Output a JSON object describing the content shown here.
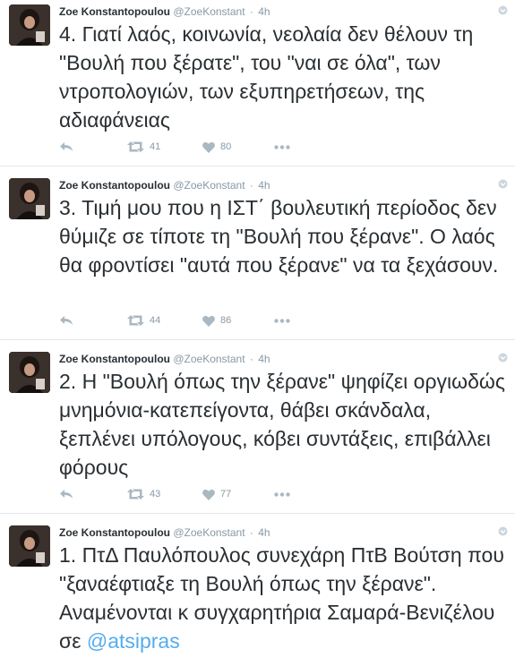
{
  "tweets": [
    {
      "fullname": "Zoe Konstantopoulou",
      "username": "@ZoeKonstant",
      "separator": "·",
      "time": "4h",
      "text": "4. Γιατί λαός, κοινωνία, νεολαία δεν θέλουν τη \"Βουλή που ξέρατε\", του \"ναι σε όλα\", των ντροπολογιών, των εξυπηρετήσεων, της αδιαφάνειας",
      "retweets": "41",
      "likes": "80"
    },
    {
      "fullname": "Zoe Konstantopoulou",
      "username": "@ZoeKonstant",
      "separator": "·",
      "time": "4h",
      "text": "3. Τιμή μου που η ΙΣΤ΄ βουλευτική περίοδος δεν θύμιζε σε τίποτε τη \"Βουλή που ξέρανε\". Ο λαός θα φροντίσει \"αυτά που ξέρανε\" να τα ξεχάσουν.",
      "retweets": "44",
      "likes": "86"
    },
    {
      "fullname": "Zoe Konstantopoulou",
      "username": "@ZoeKonstant",
      "separator": "·",
      "time": "4h",
      "text": "2. Η \"Βουλή όπως την ξέρανε\" ψηφίζει οργιωδώς μνημόνια-κατεπείγοντα, θάβει σκάνδαλα, ξεπλένει υπόλογους, κόβει συντάξεις, επιβάλλει φόρους",
      "retweets": "43",
      "likes": "77"
    },
    {
      "fullname": "Zoe Konstantopoulou",
      "username": "@ZoeKonstant",
      "separator": "·",
      "time": "4h",
      "text": "1. ΠτΔ Παυλόπουλος συνεχάρη ΠτΒ Βούτση που \"ξαναέφτιαξε τη Βουλή όπως την ξέρανε\". Αναμένονται κ συγχαρητήρια Σαμαρά-Βενιζέλου σε ",
      "mention": "@atsipras"
    }
  ],
  "icons": {
    "reply": "reply-icon",
    "retweet": "retweet-icon",
    "like": "heart-icon",
    "more": "more-icon",
    "caret": "caret-icon"
  },
  "colors": {
    "text": "#292f33",
    "meta": "#8899a6",
    "link": "#55acee",
    "border": "#e1e8ed"
  }
}
